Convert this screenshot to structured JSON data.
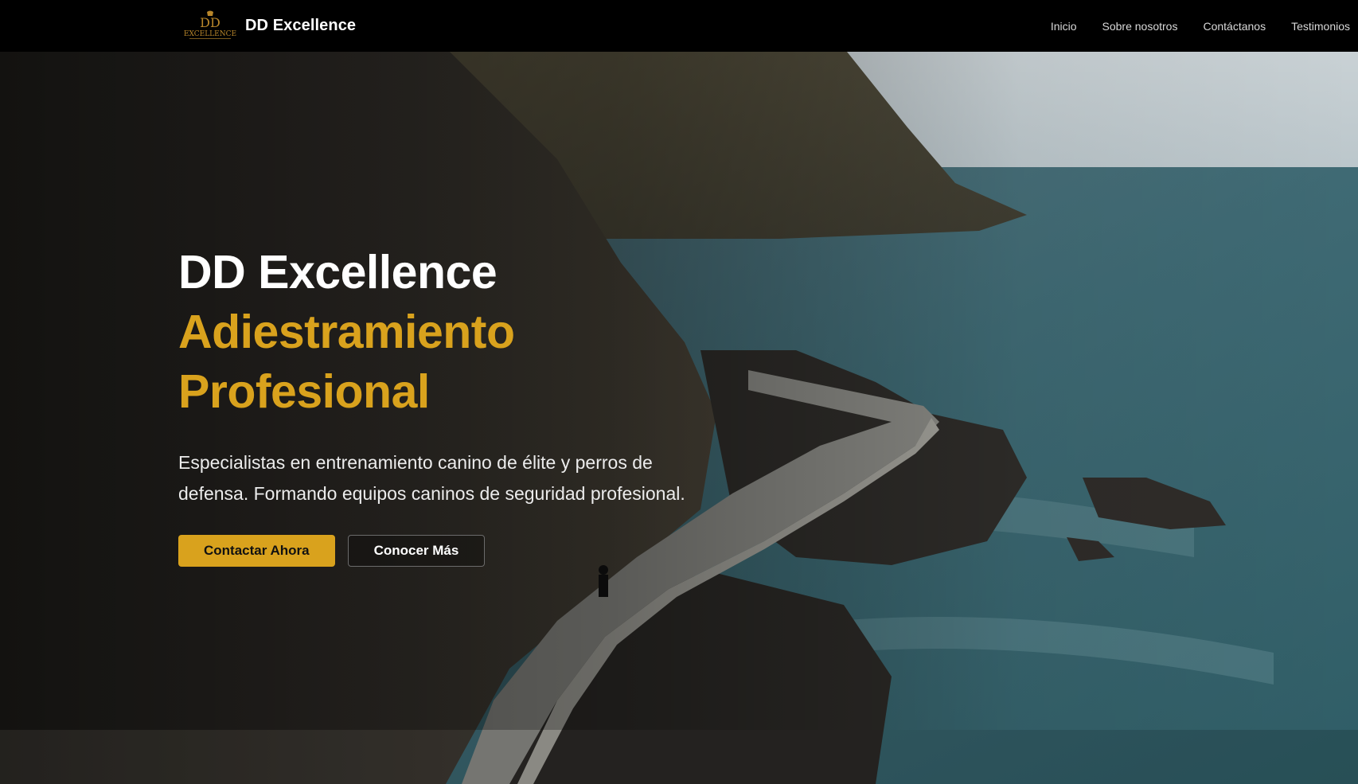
{
  "navbar": {
    "logo_icon": "dd-excellence-logo",
    "brand_name": "DD Excellence",
    "links": [
      {
        "label": "Inicio"
      },
      {
        "label": "Sobre nosotros"
      },
      {
        "label": "Contáctanos"
      },
      {
        "label": "Testimonios"
      }
    ]
  },
  "hero": {
    "title_line_1": "DD Excellence",
    "title_line_2": "Adiestramiento",
    "title_line_3": "Profesional",
    "subtitle": "Especialistas en entrenamiento canino de élite y perros de defensa. Formando equipos caninos de seguridad profesional.",
    "primary_button": "Contactar Ahora",
    "secondary_button": "Conocer Más",
    "background_image": "coastal-cliff-walkway-photo"
  },
  "colors": {
    "accent_gold": "#d9a21d",
    "navbar_bg": "#000000",
    "text_white": "#ffffff"
  }
}
